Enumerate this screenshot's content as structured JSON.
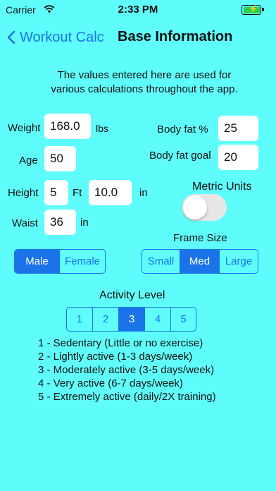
{
  "status": {
    "carrier": "Carrier",
    "time": "2:33 PM"
  },
  "nav": {
    "back_label": "Workout Calc",
    "title": "Base Information"
  },
  "intro": {
    "line1": "The values entered here are used for",
    "line2": "various calculations throughout the app."
  },
  "form": {
    "weight_label": "Weight",
    "weight_value": "168.0",
    "weight_unit": "lbs",
    "age_label": "Age",
    "age_value": "50",
    "height_label": "Height",
    "height_ft_value": "5",
    "height_ft_unit": "Ft",
    "height_in_value": "10.0",
    "height_in_unit": "in",
    "waist_label": "Waist",
    "waist_value": "36",
    "waist_unit": "in",
    "bodyfat_label": "Body fat %",
    "bodyfat_value": "25",
    "bodyfat_goal_label": "Body fat goal",
    "bodyfat_goal_value": "20",
    "metric_label": "Metric Units",
    "metric_on": false
  },
  "gender": {
    "options": [
      "Male",
      "Female"
    ],
    "selected": "Male"
  },
  "frame": {
    "label": "Frame Size",
    "options": [
      "Small",
      "Med",
      "Large"
    ],
    "selected": "Med"
  },
  "activity": {
    "label": "Activity Level",
    "options": [
      "1",
      "2",
      "3",
      "4",
      "5"
    ],
    "selected": "3",
    "descriptions": [
      "1 - Sedentary (Little or no exercise)",
      "2 - Lightly active (1-3 days/week)",
      "3 - Moderately active (3-5 days/week)",
      "4 - Very active (6-7 days/week)",
      "5 - Extremely active (daily/2X training)"
    ]
  },
  "colors": {
    "background": "#5ffcfc",
    "accent": "#1a73e8",
    "field": "#ffffff"
  },
  "icons": {
    "back": "chevron-left-icon",
    "wifi": "wifi-icon",
    "battery": "battery-icon"
  }
}
